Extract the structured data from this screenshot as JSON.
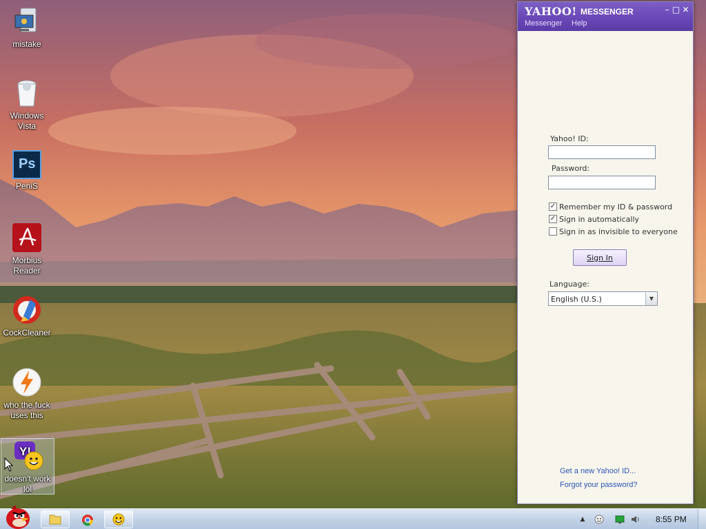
{
  "desktop": {
    "icons": [
      {
        "label_line1": "mistake",
        "label_line2": ""
      },
      {
        "label_line1": "Windows",
        "label_line2": "Vista"
      },
      {
        "label_line1": "PeniS",
        "label_line2": ""
      },
      {
        "label_line1": "Morbius",
        "label_line2": "Reader"
      },
      {
        "label_line1": "CockCleaner",
        "label_line2": ""
      },
      {
        "label_line1": "who the fuck",
        "label_line2": "uses this"
      },
      {
        "label_line1": "doesn't work",
        "label_line2": "lol"
      }
    ],
    "ps_glyph": "Ps"
  },
  "messenger": {
    "logo": "YAHOO!",
    "product": "MESSENGER",
    "controls": {
      "minimize": "–",
      "maximize": "□",
      "close": "✕"
    },
    "menu": [
      "Messenger",
      "Help"
    ],
    "id_label": "Yahoo! ID:",
    "id_value": "",
    "password_label": "Password:",
    "password_value": "",
    "options": [
      {
        "label": "Remember my ID & password",
        "checked": true
      },
      {
        "label": "Sign in automatically",
        "checked": true
      },
      {
        "label": "Sign in as invisible to everyone",
        "checked": false
      }
    ],
    "signin_button": "Sign In",
    "language_label": "Language:",
    "language_value": "English (U.S.)",
    "links": [
      "Get a new Yahoo! ID...",
      "Forgot your password?"
    ],
    "accent": "#6a48b8"
  },
  "taskbar": {
    "clock": "8:55 PM"
  }
}
